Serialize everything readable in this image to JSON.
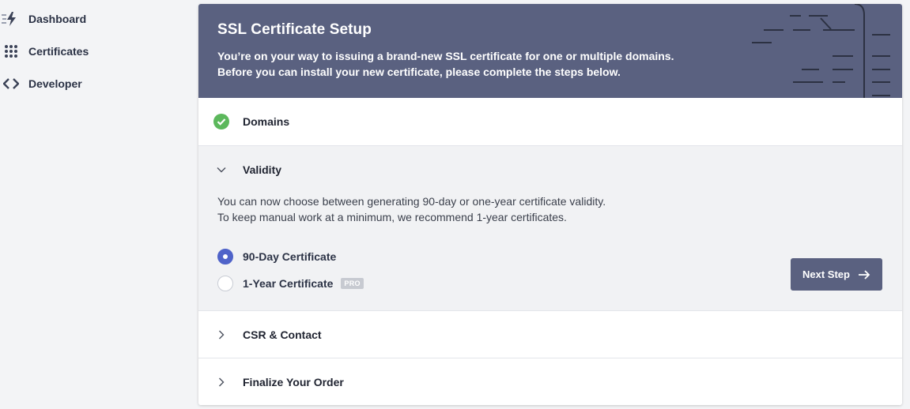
{
  "sidebar": {
    "items": [
      {
        "label": "Dashboard",
        "icon": "lightning-icon"
      },
      {
        "label": "Certificates",
        "icon": "grid-icon"
      },
      {
        "label": "Developer",
        "icon": "code-icon"
      }
    ]
  },
  "header": {
    "title": "SSL Certificate Setup",
    "desc_line1": "You’re on your way to issuing a brand-new SSL certificate for one or multiple domains.",
    "desc_line2": "Before you can install your new certificate, please complete the steps below."
  },
  "steps": {
    "domains": {
      "label": "Domains",
      "status": "complete",
      "icon": "check-circle-icon"
    },
    "validity": {
      "label": "Validity",
      "text_line1": "You can now choose between generating 90-day or one-year certificate validity.",
      "text_line2": "To keep manual work at a minimum, we recommend 1-year certificates.",
      "options": [
        {
          "label": "90-Day Certificate",
          "selected": true
        },
        {
          "label": "1-Year Certificate",
          "selected": false,
          "badge": "PRO"
        }
      ],
      "next_label": "Next Step"
    },
    "csr": {
      "label": "CSR & Contact"
    },
    "finalize": {
      "label": "Finalize Your Order"
    }
  },
  "colors": {
    "header_bg": "#5a6180",
    "accent": "#4f63c9",
    "success": "#5cb85c",
    "page_bg": "#f3f4f6"
  }
}
